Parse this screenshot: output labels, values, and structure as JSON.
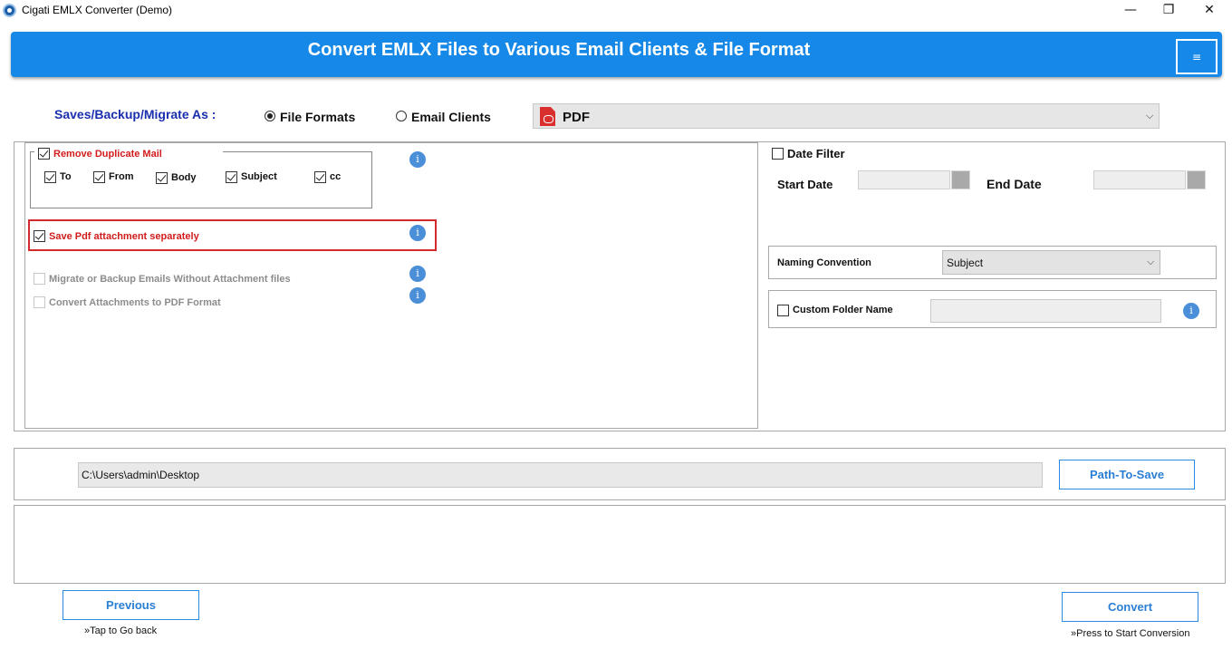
{
  "window": {
    "title": "Cigati EMLX Converter (Demo)",
    "minimize": "—",
    "restore": "❐",
    "close": "✕"
  },
  "header": {
    "title": "Convert EMLX Files to Various Email Clients & File Format",
    "menu_icon": "≡"
  },
  "save_as": {
    "label": "Saves/Backup/Migrate As :",
    "options": [
      {
        "label": "File Formats",
        "selected": true
      },
      {
        "label": "Email Clients",
        "selected": false
      }
    ],
    "format_icon": "pdf-icon",
    "selected_format": "PDF"
  },
  "duplicate": {
    "label": "Remove Duplicate Mail",
    "checked": true,
    "fields": [
      {
        "label": "To",
        "checked": true
      },
      {
        "label": "From",
        "checked": true
      },
      {
        "label": "Body",
        "checked": true
      },
      {
        "label": "Subject",
        "checked": true
      },
      {
        "label": "cc",
        "checked": true
      }
    ]
  },
  "options": {
    "save_pdf_attachment": {
      "label": "Save Pdf attachment separately",
      "checked": true
    },
    "migrate_without_attachment": {
      "label": "Migrate or Backup Emails Without Attachment files",
      "checked": false,
      "enabled": false
    },
    "convert_attachments_pdf": {
      "label": "Convert Attachments to PDF Format",
      "checked": false,
      "enabled": false
    },
    "info_glyph": "i"
  },
  "date_filter": {
    "label": "Date Filter",
    "checked": false,
    "start_label": "Start Date",
    "end_label": "End Date"
  },
  "naming": {
    "label": "Naming Convention",
    "value": "Subject"
  },
  "custom_folder": {
    "label": "Custom Folder Name",
    "checked": false
  },
  "path": {
    "value": "C:\\Users\\admin\\Desktop",
    "button": "Path-To-Save"
  },
  "nav": {
    "previous": "Previous",
    "previous_hint": "»Tap to Go back",
    "convert": "Convert",
    "convert_hint": "»Press to Start Conversion"
  },
  "colors": {
    "banner": "#1688e8",
    "accent_text": "#2a7fd4",
    "highlight": "#d42a2a",
    "label_blue": "#1a2fae"
  }
}
